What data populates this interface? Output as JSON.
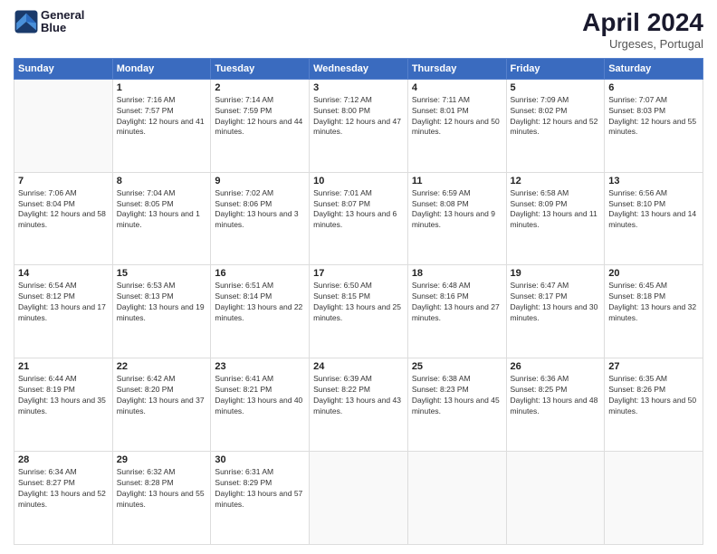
{
  "header": {
    "logo_line1": "General",
    "logo_line2": "Blue",
    "title": "April 2024",
    "subtitle": "Urgeses, Portugal"
  },
  "days_of_week": [
    "Sunday",
    "Monday",
    "Tuesday",
    "Wednesday",
    "Thursday",
    "Friday",
    "Saturday"
  ],
  "weeks": [
    [
      {
        "day": "",
        "sunrise": "",
        "sunset": "",
        "daylight": ""
      },
      {
        "day": "1",
        "sunrise": "Sunrise: 7:16 AM",
        "sunset": "Sunset: 7:57 PM",
        "daylight": "Daylight: 12 hours and 41 minutes."
      },
      {
        "day": "2",
        "sunrise": "Sunrise: 7:14 AM",
        "sunset": "Sunset: 7:59 PM",
        "daylight": "Daylight: 12 hours and 44 minutes."
      },
      {
        "day": "3",
        "sunrise": "Sunrise: 7:12 AM",
        "sunset": "Sunset: 8:00 PM",
        "daylight": "Daylight: 12 hours and 47 minutes."
      },
      {
        "day": "4",
        "sunrise": "Sunrise: 7:11 AM",
        "sunset": "Sunset: 8:01 PM",
        "daylight": "Daylight: 12 hours and 50 minutes."
      },
      {
        "day": "5",
        "sunrise": "Sunrise: 7:09 AM",
        "sunset": "Sunset: 8:02 PM",
        "daylight": "Daylight: 12 hours and 52 minutes."
      },
      {
        "day": "6",
        "sunrise": "Sunrise: 7:07 AM",
        "sunset": "Sunset: 8:03 PM",
        "daylight": "Daylight: 12 hours and 55 minutes."
      }
    ],
    [
      {
        "day": "7",
        "sunrise": "Sunrise: 7:06 AM",
        "sunset": "Sunset: 8:04 PM",
        "daylight": "Daylight: 12 hours and 58 minutes."
      },
      {
        "day": "8",
        "sunrise": "Sunrise: 7:04 AM",
        "sunset": "Sunset: 8:05 PM",
        "daylight": "Daylight: 13 hours and 1 minute."
      },
      {
        "day": "9",
        "sunrise": "Sunrise: 7:02 AM",
        "sunset": "Sunset: 8:06 PM",
        "daylight": "Daylight: 13 hours and 3 minutes."
      },
      {
        "day": "10",
        "sunrise": "Sunrise: 7:01 AM",
        "sunset": "Sunset: 8:07 PM",
        "daylight": "Daylight: 13 hours and 6 minutes."
      },
      {
        "day": "11",
        "sunrise": "Sunrise: 6:59 AM",
        "sunset": "Sunset: 8:08 PM",
        "daylight": "Daylight: 13 hours and 9 minutes."
      },
      {
        "day": "12",
        "sunrise": "Sunrise: 6:58 AM",
        "sunset": "Sunset: 8:09 PM",
        "daylight": "Daylight: 13 hours and 11 minutes."
      },
      {
        "day": "13",
        "sunrise": "Sunrise: 6:56 AM",
        "sunset": "Sunset: 8:10 PM",
        "daylight": "Daylight: 13 hours and 14 minutes."
      }
    ],
    [
      {
        "day": "14",
        "sunrise": "Sunrise: 6:54 AM",
        "sunset": "Sunset: 8:12 PM",
        "daylight": "Daylight: 13 hours and 17 minutes."
      },
      {
        "day": "15",
        "sunrise": "Sunrise: 6:53 AM",
        "sunset": "Sunset: 8:13 PM",
        "daylight": "Daylight: 13 hours and 19 minutes."
      },
      {
        "day": "16",
        "sunrise": "Sunrise: 6:51 AM",
        "sunset": "Sunset: 8:14 PM",
        "daylight": "Daylight: 13 hours and 22 minutes."
      },
      {
        "day": "17",
        "sunrise": "Sunrise: 6:50 AM",
        "sunset": "Sunset: 8:15 PM",
        "daylight": "Daylight: 13 hours and 25 minutes."
      },
      {
        "day": "18",
        "sunrise": "Sunrise: 6:48 AM",
        "sunset": "Sunset: 8:16 PM",
        "daylight": "Daylight: 13 hours and 27 minutes."
      },
      {
        "day": "19",
        "sunrise": "Sunrise: 6:47 AM",
        "sunset": "Sunset: 8:17 PM",
        "daylight": "Daylight: 13 hours and 30 minutes."
      },
      {
        "day": "20",
        "sunrise": "Sunrise: 6:45 AM",
        "sunset": "Sunset: 8:18 PM",
        "daylight": "Daylight: 13 hours and 32 minutes."
      }
    ],
    [
      {
        "day": "21",
        "sunrise": "Sunrise: 6:44 AM",
        "sunset": "Sunset: 8:19 PM",
        "daylight": "Daylight: 13 hours and 35 minutes."
      },
      {
        "day": "22",
        "sunrise": "Sunrise: 6:42 AM",
        "sunset": "Sunset: 8:20 PM",
        "daylight": "Daylight: 13 hours and 37 minutes."
      },
      {
        "day": "23",
        "sunrise": "Sunrise: 6:41 AM",
        "sunset": "Sunset: 8:21 PM",
        "daylight": "Daylight: 13 hours and 40 minutes."
      },
      {
        "day": "24",
        "sunrise": "Sunrise: 6:39 AM",
        "sunset": "Sunset: 8:22 PM",
        "daylight": "Daylight: 13 hours and 43 minutes."
      },
      {
        "day": "25",
        "sunrise": "Sunrise: 6:38 AM",
        "sunset": "Sunset: 8:23 PM",
        "daylight": "Daylight: 13 hours and 45 minutes."
      },
      {
        "day": "26",
        "sunrise": "Sunrise: 6:36 AM",
        "sunset": "Sunset: 8:25 PM",
        "daylight": "Daylight: 13 hours and 48 minutes."
      },
      {
        "day": "27",
        "sunrise": "Sunrise: 6:35 AM",
        "sunset": "Sunset: 8:26 PM",
        "daylight": "Daylight: 13 hours and 50 minutes."
      }
    ],
    [
      {
        "day": "28",
        "sunrise": "Sunrise: 6:34 AM",
        "sunset": "Sunset: 8:27 PM",
        "daylight": "Daylight: 13 hours and 52 minutes."
      },
      {
        "day": "29",
        "sunrise": "Sunrise: 6:32 AM",
        "sunset": "Sunset: 8:28 PM",
        "daylight": "Daylight: 13 hours and 55 minutes."
      },
      {
        "day": "30",
        "sunrise": "Sunrise: 6:31 AM",
        "sunset": "Sunset: 8:29 PM",
        "daylight": "Daylight: 13 hours and 57 minutes."
      },
      {
        "day": "",
        "sunrise": "",
        "sunset": "",
        "daylight": ""
      },
      {
        "day": "",
        "sunrise": "",
        "sunset": "",
        "daylight": ""
      },
      {
        "day": "",
        "sunrise": "",
        "sunset": "",
        "daylight": ""
      },
      {
        "day": "",
        "sunrise": "",
        "sunset": "",
        "daylight": ""
      }
    ]
  ]
}
